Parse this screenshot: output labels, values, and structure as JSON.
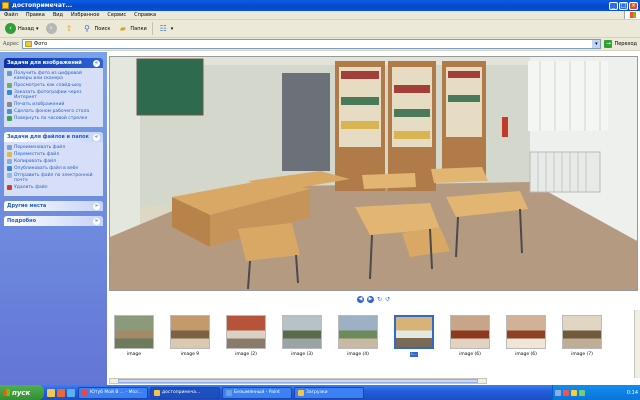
{
  "window": {
    "title": "достопримечат..."
  },
  "menubar": {
    "items": [
      "Файл",
      "Правка",
      "Вид",
      "Избранное",
      "Сервис",
      "Справка"
    ]
  },
  "toolbar": {
    "back_label": "Назад",
    "search_label": "Поиск",
    "folders_label": "Папки"
  },
  "addressbar": {
    "label": "Адрес",
    "path": "Фото",
    "go_label": "Переход"
  },
  "sidebar": {
    "image_tasks": {
      "title": "Задачи для изображений",
      "items": [
        "Получить фото из цифровой камеры или сканера",
        "Просмотреть как слайд-шоу",
        "Заказать фотографии через Интернет",
        "Печать изображений",
        "Сделать фоном рабочего стола",
        "Повернуть по часовой стрелке"
      ]
    },
    "file_tasks": {
      "title": "Задачи для файлов и папок",
      "items": [
        "Переименовать файл",
        "Переместить файл",
        "Копировать файл",
        "Опубликовать файл в вебе",
        "Отправить файл по электронной почте",
        "Удалить файл"
      ]
    },
    "other_places": {
      "title": "Другие места"
    },
    "details": {
      "title": "Подробно"
    }
  },
  "viewer": {
    "thumbnails": [
      {
        "caption": "image",
        "selected": false,
        "colors": [
          "#8a9a7a",
          "#a58a6a",
          "#6b7b5b"
        ]
      },
      {
        "caption": "image 9",
        "selected": false,
        "colors": [
          "#c49a6c",
          "#7b6245",
          "#d8c9b0"
        ]
      },
      {
        "caption": "image (2)",
        "selected": false,
        "colors": [
          "#b5543a",
          "#d9d2c4",
          "#8a7a6a"
        ]
      },
      {
        "caption": "image (3)",
        "selected": false,
        "colors": [
          "#b6c2c8",
          "#5a6a4a",
          "#9aa3a6"
        ]
      },
      {
        "caption": "image (4)",
        "selected": false,
        "colors": [
          "#9db0c4",
          "#6d8a5a",
          "#c9b8a2"
        ]
      },
      {
        "caption": "i...",
        "selected": true,
        "colors": [
          "#d7b377",
          "#e3e8e0",
          "#7a6a55"
        ]
      },
      {
        "caption": "image (6)",
        "selected": false,
        "colors": [
          "#c8a489",
          "#8b3a1f",
          "#e1d2c2"
        ]
      },
      {
        "caption": "image (6)",
        "selected": false,
        "colors": [
          "#d2b296",
          "#8e4124",
          "#efe6d7"
        ]
      },
      {
        "caption": "image (7)",
        "selected": false,
        "colors": [
          "#e1d6c4",
          "#6f5a3e",
          "#bfae95"
        ]
      }
    ]
  },
  "taskbar": {
    "start_label": "пуск",
    "tasks": [
      {
        "label": "Ютуб Мой В ... - Micr...",
        "active": false
      },
      {
        "label": "достопримеча...",
        "active": true
      },
      {
        "label": "Безымянный - Paint",
        "active": false
      },
      {
        "label": "Загрузки",
        "active": false
      }
    ],
    "time": "0:14"
  }
}
